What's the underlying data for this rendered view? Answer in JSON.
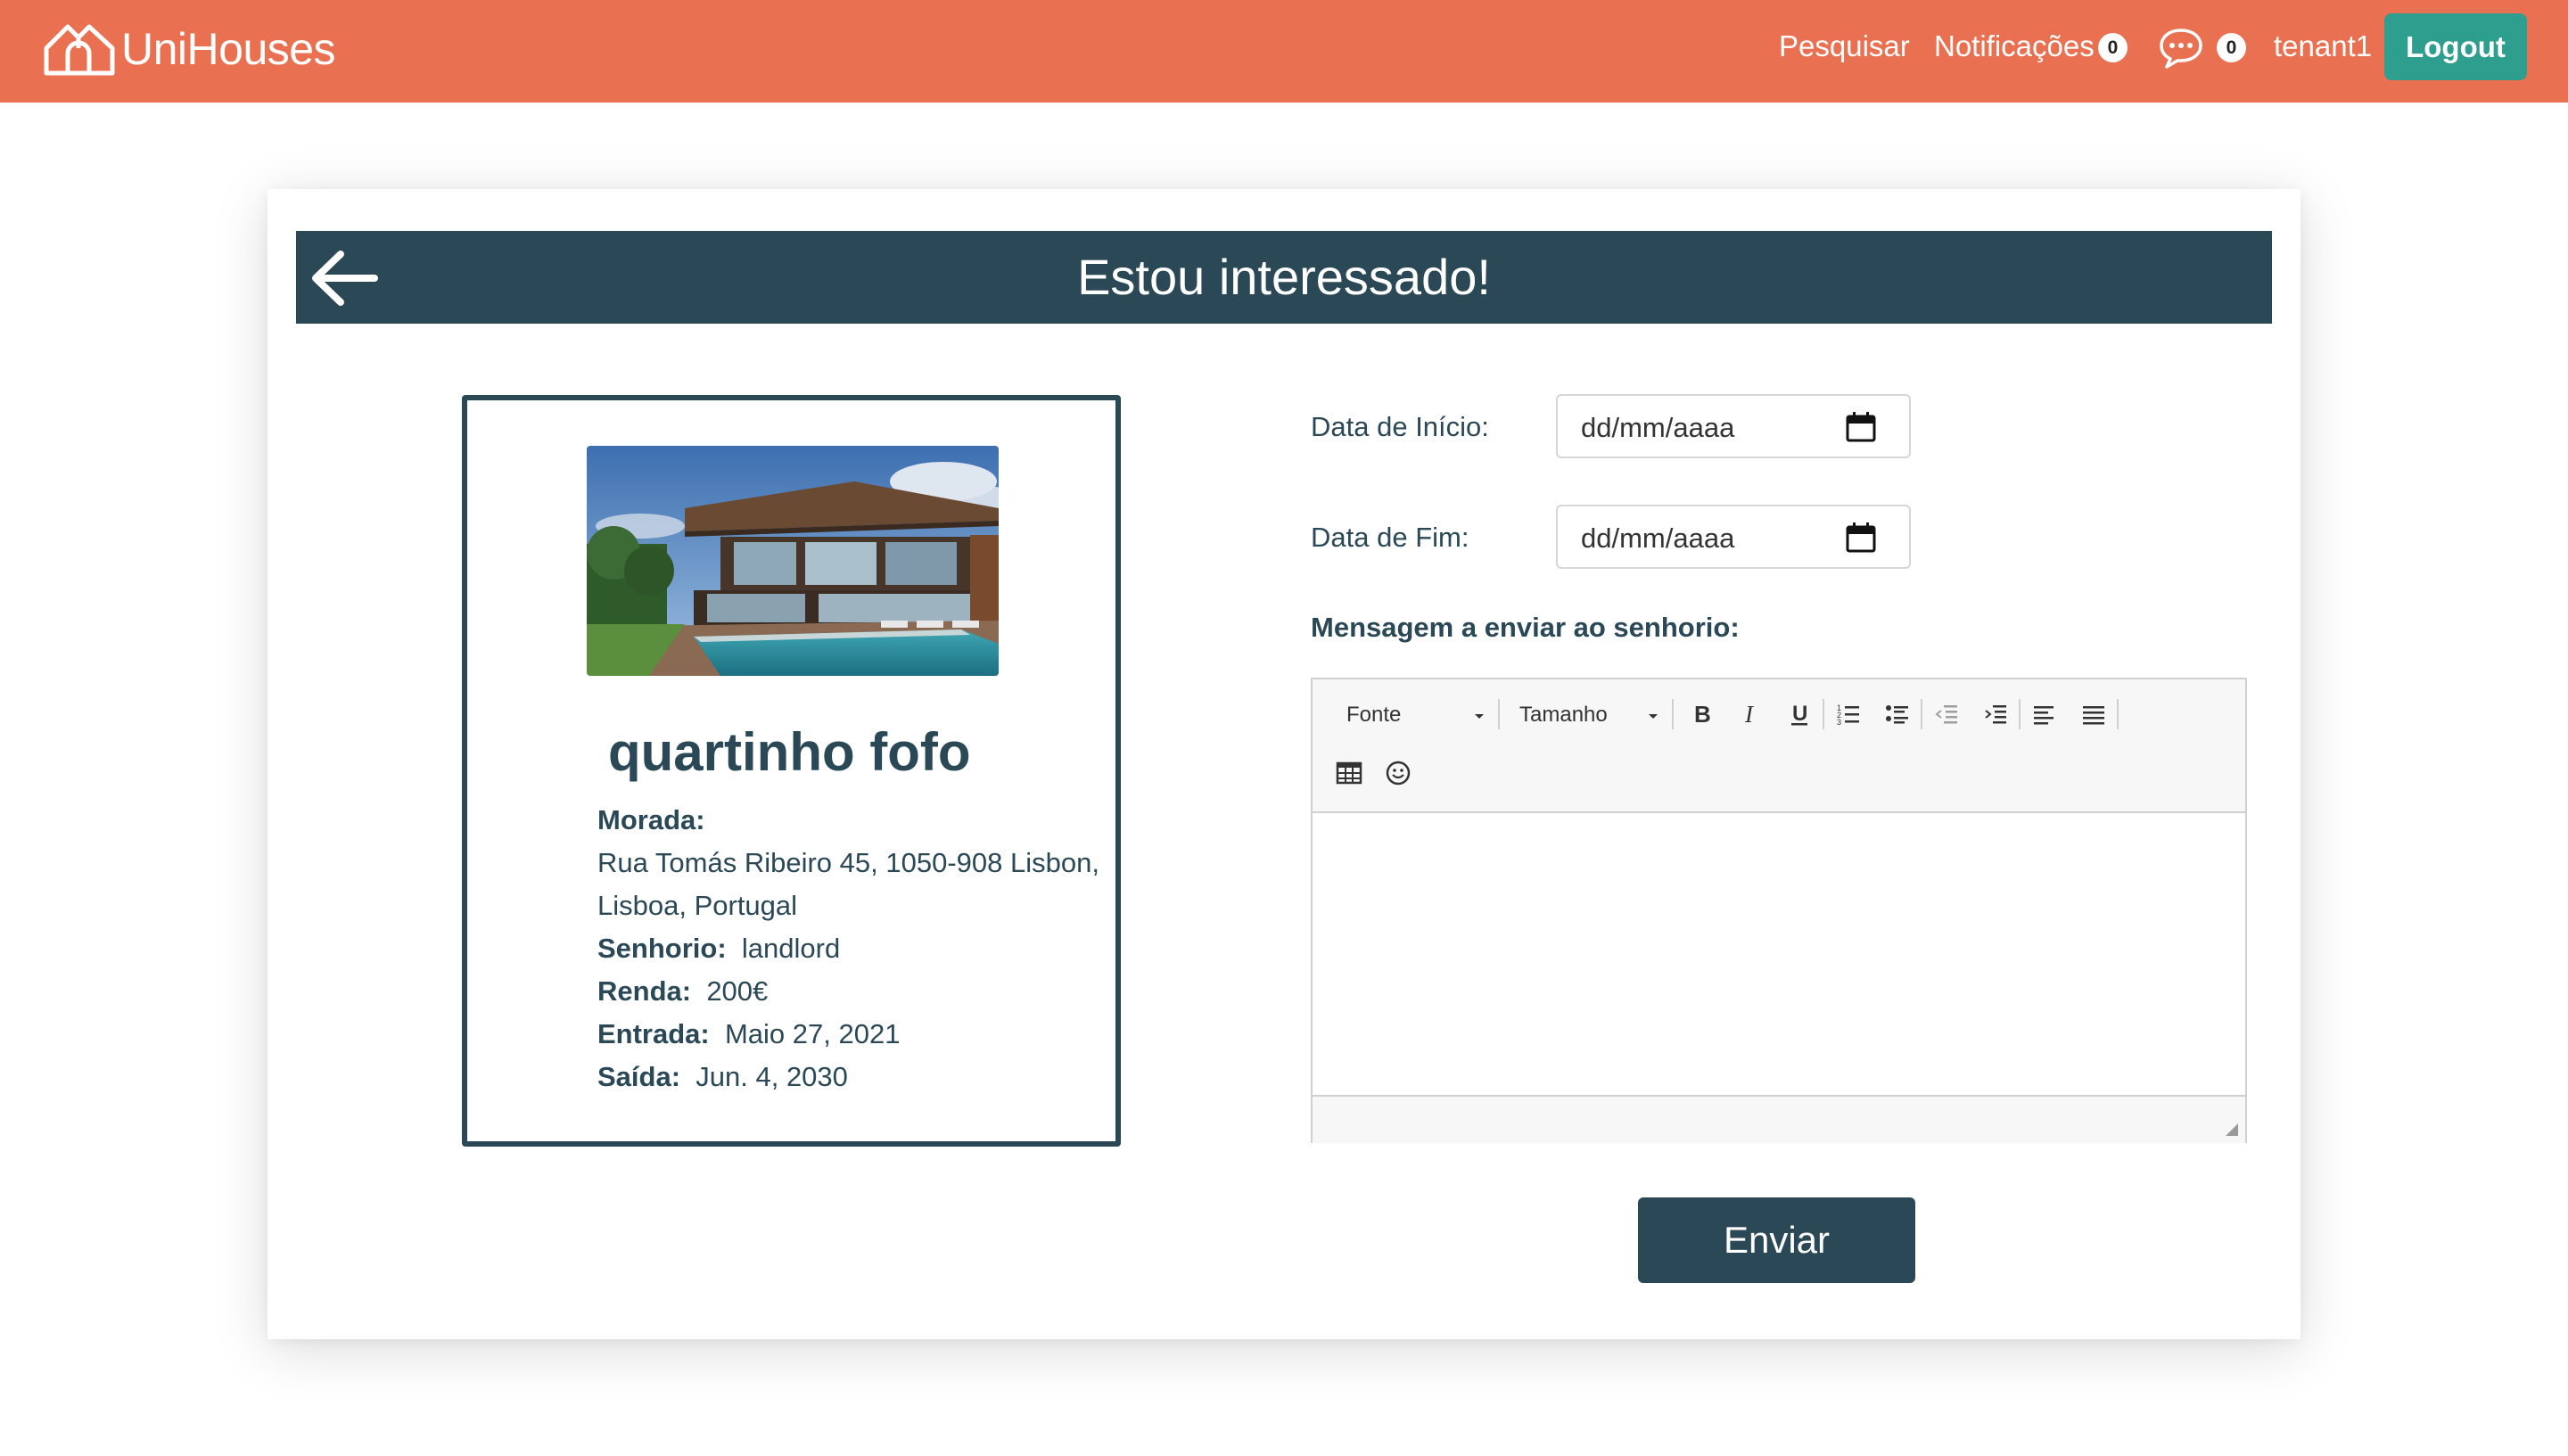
{
  "navbar": {
    "brand": "UniHouses",
    "search_link": "Pesquisar",
    "notifications_link": "Notificações",
    "notifications_count": "0",
    "messages_count": "0",
    "username": "tenant1",
    "logout_label": "Logout",
    "colors": {
      "background": "#e97152",
      "logout": "#2e9e8f"
    }
  },
  "header": {
    "title": "Estou interessado!",
    "back_icon": "arrow-left-icon",
    "color": "#2a4856"
  },
  "listing": {
    "title": "quartinho fofo",
    "address_label": "Morada:",
    "address_line1": "Rua Tomás Ribeiro 45, 1050-908 Lisbon,",
    "address_line2": "Lisboa, Portugal",
    "landlord_label": "Senhorio:",
    "landlord_value": "landlord",
    "rent_label": "Renda:",
    "rent_value": "200€",
    "entry_label": "Entrada:",
    "entry_value": "Maio 27, 2021",
    "exit_label": "Saída:",
    "exit_value": "Jun. 4, 2030"
  },
  "form": {
    "start_date_label": "Data de Início:",
    "start_date_placeholder": "dd/mm/aaaa",
    "end_date_label": "Data de Fim:",
    "end_date_placeholder": "dd/mm/aaaa",
    "message_label": "Mensagem a enviar ao senhorio:",
    "editor": {
      "font_select": "Fonte",
      "size_select": "Tamanho",
      "tools": [
        "bold-icon",
        "italic-icon",
        "underline-icon",
        "ordered-list-icon",
        "unordered-list-icon",
        "outdent-icon",
        "indent-icon",
        "align-left-icon",
        "justify-icon",
        "table-icon",
        "emoji-icon"
      ]
    },
    "send_label": "Enviar"
  }
}
